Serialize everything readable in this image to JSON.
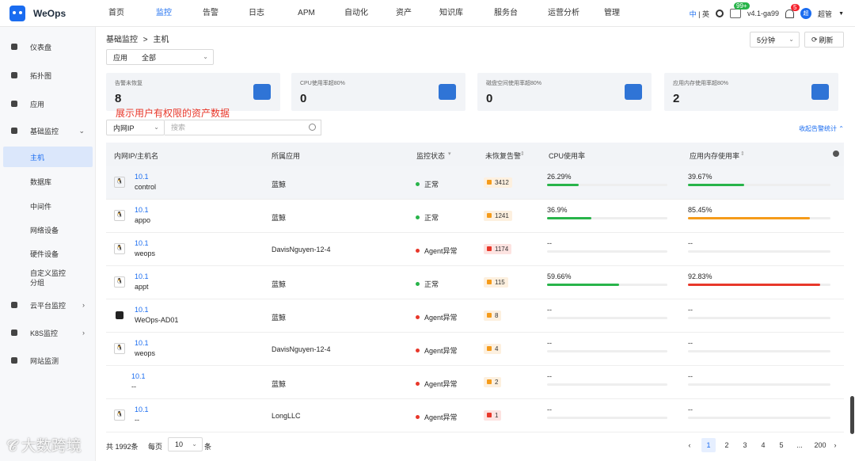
{
  "app": {
    "name": "WeOps"
  },
  "nav": [
    {
      "label": "首页"
    },
    {
      "label": "监控"
    },
    {
      "label": "告警"
    },
    {
      "label": "日志"
    },
    {
      "label": "APM"
    },
    {
      "label": "自动化"
    },
    {
      "label": "资产"
    },
    {
      "label": "知识库"
    },
    {
      "label": "服务台"
    },
    {
      "label": "运营分析"
    },
    {
      "label": "管理"
    }
  ],
  "nav_active": "监控",
  "topright": {
    "lang_zh": "中",
    "lang_sep": "|",
    "lang_en": "英",
    "update_badge": "99+",
    "version": "v4.1-ga99",
    "version_badge_icon": "question-icon",
    "alarm_badge": "5",
    "avatar_text": "超",
    "user": "超管"
  },
  "sidebar": {
    "items": [
      {
        "label": "仪表盘",
        "icon": "dashboard-icon"
      },
      {
        "label": "拓扑图",
        "icon": "topology-icon"
      },
      {
        "label": "应用",
        "icon": "apps-icon"
      },
      {
        "label": "基础监控",
        "icon": "monitor-icon"
      },
      {
        "label": "主机"
      },
      {
        "label": "数据库"
      },
      {
        "label": "中间件"
      },
      {
        "label": "网络设备"
      },
      {
        "label": "硬件设备"
      },
      {
        "label": "自定义监控分组"
      },
      {
        "label": "云平台监控",
        "icon": "cloud-icon"
      },
      {
        "label": "K8S监控",
        "icon": "k8s-icon"
      },
      {
        "label": "网站监测",
        "icon": "web-icon"
      }
    ]
  },
  "breadcrumb": {
    "root": "基础监控",
    "sep": ">",
    "current": "主机"
  },
  "filter": {
    "app_label": "应用",
    "app_value": "全部"
  },
  "refresh": {
    "interval": "5分钟",
    "button": "刷新"
  },
  "cards": [
    {
      "title": "告警未恢复",
      "value": "8"
    },
    {
      "title": "CPU使用率超80%",
      "value": "0"
    },
    {
      "title": "磁盘空间使用率超80%",
      "value": "0"
    },
    {
      "title": "应用内存使用率超80%",
      "value": "2"
    }
  ],
  "overlay_note": "展示用户有权限的资产数据",
  "search": {
    "field": "内网IP",
    "placeholder": "搜索"
  },
  "collapse_label": "收起告警统计",
  "table": {
    "headers": [
      "内网IP/主机名",
      "所属应用",
      "监控状态",
      "未恢复告警",
      "CPU使用率",
      "应用内存使用率"
    ],
    "rows": [
      {
        "os": "linux",
        "ip": "10.1",
        "host": "control",
        "app": "蓝鲸",
        "status": "正常",
        "status_color": "#28b44a",
        "alarm": "3412",
        "alarm_level": "orange",
        "cpu": "26.29%",
        "cpu_pct": 26.29,
        "cpu_color": "#28b44a",
        "mem": "39.67%",
        "mem_pct": 39.67,
        "mem_color": "#28b44a"
      },
      {
        "os": "linux",
        "ip": "10.1",
        "host": "appo",
        "app": "蓝鲸",
        "status": "正常",
        "status_color": "#28b44a",
        "alarm": "1241",
        "alarm_level": "orange",
        "cpu": "36.9%",
        "cpu_pct": 36.9,
        "cpu_color": "#28b44a",
        "mem": "85.45%",
        "mem_pct": 85.45,
        "mem_color": "#f59b1a"
      },
      {
        "os": "linux",
        "ip": "10.1",
        "host": "weops",
        "app": "DavisNguyen-12-4",
        "status": "Agent异常",
        "status_color": "#e8372a",
        "alarm": "1174",
        "alarm_level": "red",
        "cpu": "--",
        "cpu_pct": 0,
        "cpu_color": "#28b44a",
        "mem": "--",
        "mem_pct": 0,
        "mem_color": "#28b44a"
      },
      {
        "os": "linux",
        "ip": "10.1",
        "host": "appt",
        "app": "蓝鲸",
        "status": "正常",
        "status_color": "#28b44a",
        "alarm": "115",
        "alarm_level": "orange",
        "cpu": "59.66%",
        "cpu_pct": 59.66,
        "cpu_color": "#28b44a",
        "mem": "92.83%",
        "mem_pct": 92.83,
        "mem_color": "#e8372a"
      },
      {
        "os": "windows",
        "ip": "10.1",
        "host": "WeOps-AD01",
        "app": "蓝鲸",
        "status": "Agent异常",
        "status_color": "#e8372a",
        "alarm": "8",
        "alarm_level": "orange",
        "cpu": "--",
        "cpu_pct": 0,
        "cpu_color": "#28b44a",
        "mem": "--",
        "mem_pct": 0,
        "mem_color": "#28b44a"
      },
      {
        "os": "linux",
        "ip": "10.1",
        "host": "weops",
        "app": "DavisNguyen-12-4",
        "status": "Agent异常",
        "status_color": "#e8372a",
        "alarm": "4",
        "alarm_level": "orange",
        "cpu": "--",
        "cpu_pct": 0,
        "cpu_color": "#28b44a",
        "mem": "--",
        "mem_pct": 0,
        "mem_color": "#28b44a"
      },
      {
        "os": "none",
        "ip": "10.1",
        "host": "--",
        "app": "蓝鲸",
        "status": "Agent异常",
        "status_color": "#e8372a",
        "alarm": "2",
        "alarm_level": "orange",
        "cpu": "--",
        "cpu_pct": 0,
        "cpu_color": "#28b44a",
        "mem": "--",
        "mem_pct": 0,
        "mem_color": "#28b44a"
      },
      {
        "os": "linux",
        "ip": "10.1",
        "host": "--",
        "app": "LongLLC",
        "status": "Agent异常",
        "status_color": "#e8372a",
        "alarm": "1",
        "alarm_level": "red",
        "cpu": "--",
        "cpu_pct": 0,
        "cpu_color": "#28b44a",
        "mem": "--",
        "mem_pct": 0,
        "mem_color": "#28b44a"
      }
    ]
  },
  "pagination": {
    "total": "1992条",
    "per_page_label": "每页",
    "per_page": "10",
    "unit": "条",
    "pages": [
      "1",
      "2",
      "3",
      "4",
      "5",
      "...",
      "200"
    ],
    "current": "1"
  },
  "watermark": "大数跨境"
}
